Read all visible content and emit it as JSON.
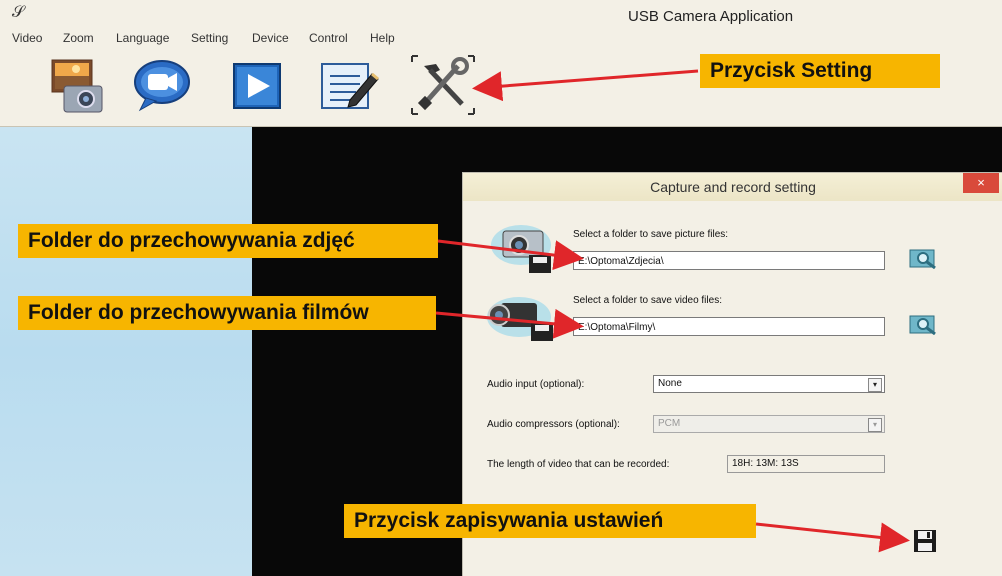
{
  "window": {
    "app_icon": "𝒮",
    "title": "USB Camera Application"
  },
  "menu": [
    "Video",
    "Zoom",
    "Language",
    "Setting",
    "Device",
    "Control",
    "Help"
  ],
  "toolbar": {
    "tools": [
      {
        "icon": "photo-camera-icon"
      },
      {
        "icon": "video-camera-icon"
      },
      {
        "icon": "play-icon"
      },
      {
        "icon": "edit-list-icon"
      },
      {
        "icon": "settings-tools-icon"
      }
    ]
  },
  "dialog": {
    "title": "Capture and record setting",
    "close_glyph": "×",
    "picture_label": "Select a folder to save picture files:",
    "picture_path": "E:\\Optoma\\Zdjecia\\",
    "video_label": "Select a folder to save video files:",
    "video_path": "E:\\Optoma\\Filmy\\",
    "audio_input_label": "Audio input (optional):",
    "audio_input_value": "None",
    "audio_comp_label": "Audio compressors (optional):",
    "audio_comp_value": "PCM",
    "length_label": "The length of video that can be recorded:",
    "length_value": "18H: 13M: 13S",
    "arrow_glyph": "▾"
  },
  "annotations": {
    "setting_button": "Przycisk Setting",
    "picture_folder": "Folder do przechowywania zdjęć",
    "video_folder": "Folder do przechowywania filmów",
    "save_button": "Przycisk zapisywania ustawień"
  },
  "colors": {
    "callout": "#f7b500",
    "arrow": "#e0262a",
    "close": "#d94a3b"
  }
}
